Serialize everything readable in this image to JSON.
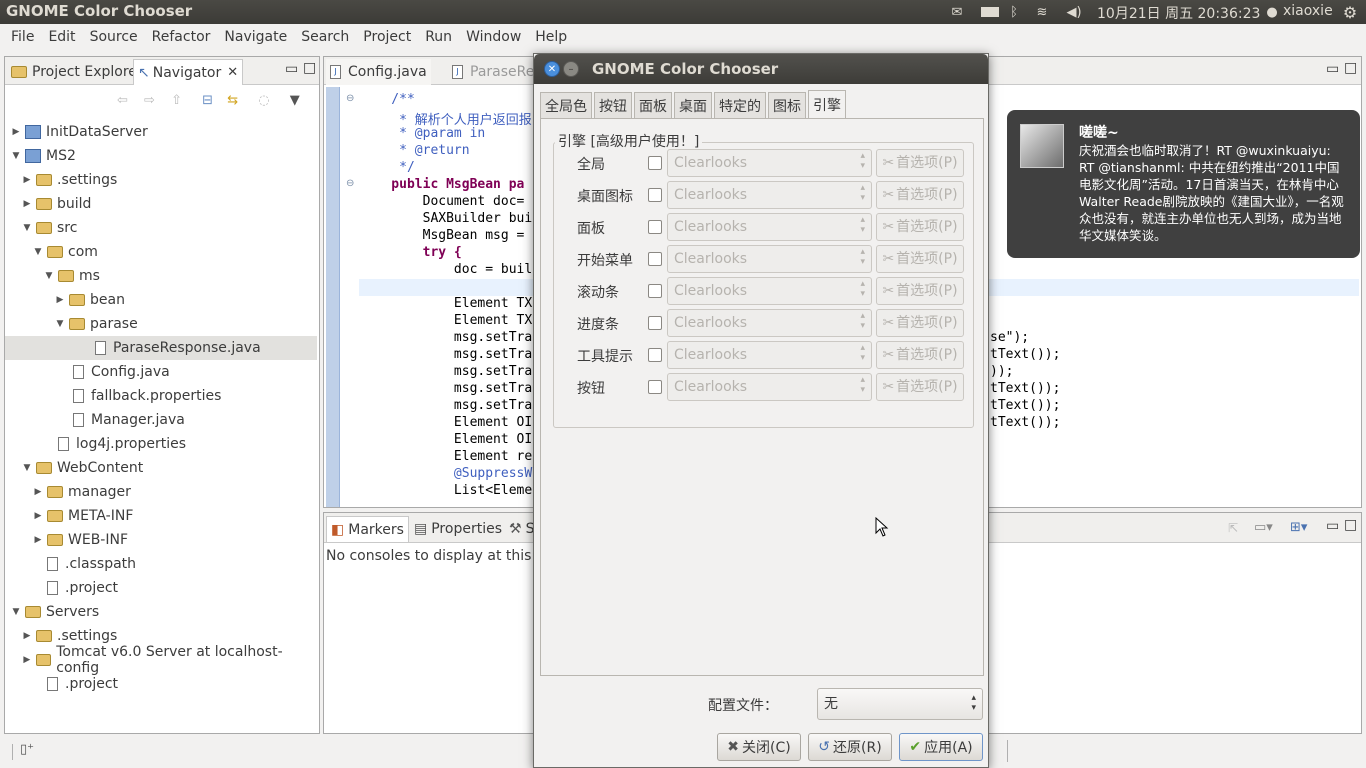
{
  "topbar": {
    "app_title": "GNOME Color Chooser",
    "clock": "10月21日 周五 20:36:23",
    "username": "xiaoxie"
  },
  "menubar": [
    "File",
    "Edit",
    "Source",
    "Refactor",
    "Navigate",
    "Search",
    "Project",
    "Run",
    "Window",
    "Help"
  ],
  "left_panel": {
    "tabs": [
      "Project Explore",
      "Navigator"
    ],
    "tree": [
      {
        "label": "InitDataServer",
        "depth": 0,
        "arrow": "▶",
        "icon": "project"
      },
      {
        "label": "MS2",
        "depth": 0,
        "arrow": "▼",
        "icon": "project"
      },
      {
        "label": ".settings",
        "depth": 1,
        "arrow": "▶",
        "icon": "folder"
      },
      {
        "label": "build",
        "depth": 1,
        "arrow": "▶",
        "icon": "folder"
      },
      {
        "label": "src",
        "depth": 1,
        "arrow": "▼",
        "icon": "folder"
      },
      {
        "label": "com",
        "depth": 2,
        "arrow": "▼",
        "icon": "folder"
      },
      {
        "label": "ms",
        "depth": 3,
        "arrow": "▼",
        "icon": "folder"
      },
      {
        "label": "bean",
        "depth": 4,
        "arrow": "▶",
        "icon": "folder"
      },
      {
        "label": "parase",
        "depth": 4,
        "arrow": "▼",
        "icon": "folder"
      },
      {
        "label": "ParaseResponse.java",
        "depth": 6,
        "arrow": "",
        "icon": "file",
        "selected": true
      },
      {
        "label": "Config.java",
        "depth": 5,
        "arrow": "",
        "icon": "file"
      },
      {
        "label": "fallback.properties",
        "depth": 5,
        "arrow": "",
        "icon": "file"
      },
      {
        "label": "Manager.java",
        "depth": 5,
        "arrow": "",
        "icon": "file"
      },
      {
        "label": "log4j.properties",
        "depth": 3,
        "arrow": "",
        "icon": "file"
      },
      {
        "label": "WebContent",
        "depth": 1,
        "arrow": "▼",
        "icon": "folder"
      },
      {
        "label": "manager",
        "depth": 2,
        "arrow": "▶",
        "icon": "folder"
      },
      {
        "label": "META-INF",
        "depth": 2,
        "arrow": "▶",
        "icon": "folder"
      },
      {
        "label": "WEB-INF",
        "depth": 2,
        "arrow": "▶",
        "icon": "folder"
      },
      {
        "label": ".classpath",
        "depth": 2,
        "arrow": "",
        "icon": "file"
      },
      {
        "label": ".project",
        "depth": 2,
        "arrow": "",
        "icon": "file"
      },
      {
        "label": "Servers",
        "depth": 0,
        "arrow": "▼",
        "icon": "folder"
      },
      {
        "label": ".settings",
        "depth": 1,
        "arrow": "▶",
        "icon": "folder"
      },
      {
        "label": "Tomcat v6.0 Server at localhost-config",
        "depth": 1,
        "arrow": "▶",
        "icon": "folder"
      },
      {
        "label": ".project",
        "depth": 2,
        "arrow": "",
        "icon": "file"
      }
    ]
  },
  "editor": {
    "tabs": [
      "Config.java",
      "ParaseRe"
    ],
    "lines": [
      {
        "text": "    /**",
        "cls": "cm"
      },
      {
        "text": "     * 解析个人用户返回报",
        "cls": "cm"
      },
      {
        "text": "     * @param in",
        "cls": "cm"
      },
      {
        "text": "     * @return",
        "cls": "cm"
      },
      {
        "text": "     */",
        "cls": "cm"
      },
      {
        "text": "    public MsgBean pa",
        "cls": "kw"
      },
      {
        "text": "        Document doc=",
        "cls": ""
      },
      {
        "text": "        SAXBuilder bui",
        "cls": ""
      },
      {
        "text": "        MsgBean msg =",
        "cls": ""
      },
      {
        "text": "        try {",
        "cls": "kw"
      },
      {
        "text": "            doc = buil",
        "cls": ""
      },
      {
        "text": "",
        "cls": ""
      },
      {
        "text": "            Element TX",
        "cls": ""
      },
      {
        "text": "            Element TX",
        "cls": ""
      },
      {
        "text": "            msg.setTra",
        "cls": ""
      },
      {
        "text": "            msg.setTra",
        "cls": ""
      },
      {
        "text": "            msg.setTra",
        "cls": ""
      },
      {
        "text": "            msg.setTra",
        "cls": ""
      },
      {
        "text": "            msg.setTra",
        "cls": ""
      },
      {
        "text": "            Element OI",
        "cls": ""
      },
      {
        "text": "            Element OI",
        "cls": ""
      },
      {
        "text": "            Element re",
        "cls": ""
      },
      {
        "text": "            @SuppressW",
        "cls": "cm"
      },
      {
        "text": "            List<Eleme",
        "cls": ""
      }
    ],
    "right_fragments": [
      "se\");",
      "tText());",
      "));",
      "tText());",
      "tText());",
      "tText());"
    ]
  },
  "bottom_panel": {
    "tabs": [
      "Markers",
      "Properties",
      "S"
    ],
    "message": "No consoles to display at this ti"
  },
  "dialog": {
    "title": "GNOME Color Chooser",
    "tabs": [
      "全局色",
      "按钮",
      "面板",
      "桌面",
      "特定的",
      "图标",
      "引擎"
    ],
    "active_tab": "引擎",
    "engine_heading": "引擎 [高级用户使用！]",
    "rows": [
      {
        "label": "全局",
        "value": "Clearlooks",
        "pref": "首选项(P)"
      },
      {
        "label": "桌面图标",
        "value": "Clearlooks",
        "pref": "首选项(P)"
      },
      {
        "label": "面板",
        "value": "Clearlooks",
        "pref": "首选项(P)"
      },
      {
        "label": "开始菜单",
        "value": "Clearlooks",
        "pref": "首选项(P)"
      },
      {
        "label": "滚动条",
        "value": "Clearlooks",
        "pref": "首选项(P)"
      },
      {
        "label": "进度条",
        "value": "Clearlooks",
        "pref": "首选项(P)"
      },
      {
        "label": "工具提示",
        "value": "Clearlooks",
        "pref": "首选项(P)"
      },
      {
        "label": "按钮",
        "value": "Clearlooks",
        "pref": "首选项(P)"
      }
    ],
    "profile_label": "配置文件：",
    "profile_value": "无",
    "buttons": {
      "close": "关闭(C)",
      "revert": "还原(R)",
      "apply": "应用(A)"
    }
  },
  "notification": {
    "title": "嗟嗟~",
    "body": "庆祝酒会也临时取消了！RT @wuxinkuaiyu: RT @tianshanml: 中共在纽约推出“2011中国电影文化周”活动。17日首演当天，在林肯中心Walter Reade剧院放映的《建国大业》，一名观众也没有，就连主办单位也无人到场，成为当地华文媒体笑谈。"
  }
}
